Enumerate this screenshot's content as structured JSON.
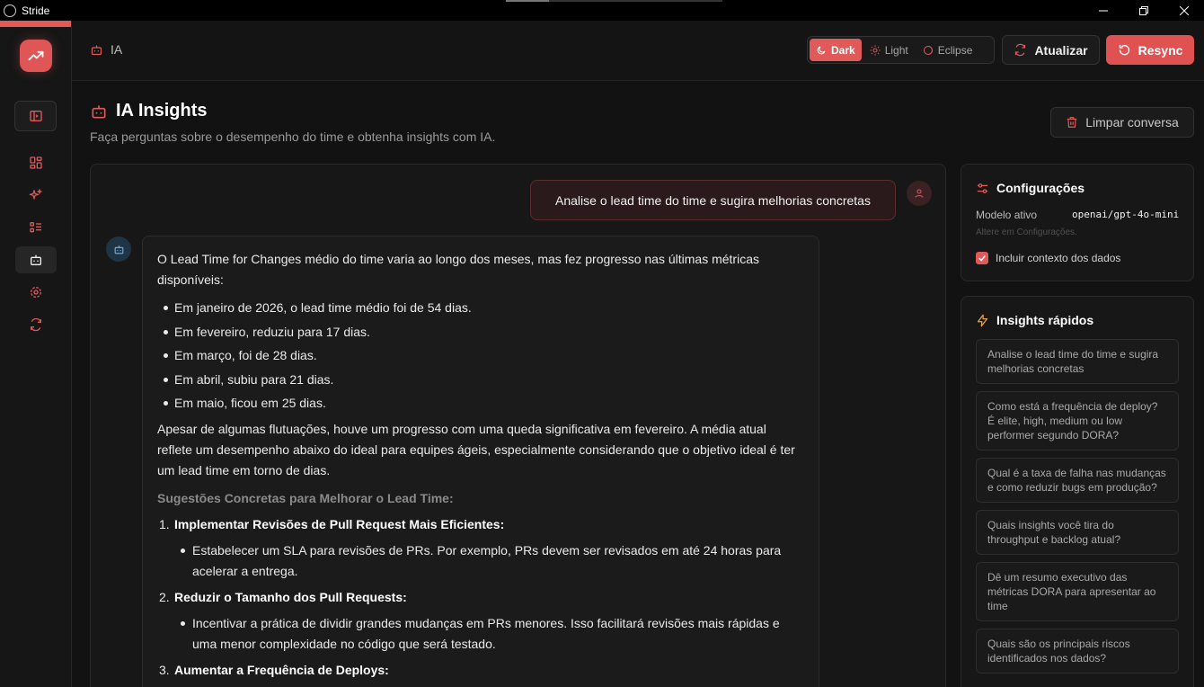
{
  "window": {
    "title": "Stride"
  },
  "topbar": {
    "breadcrumb": "IA",
    "themes": [
      "Dark",
      "Light",
      "Eclipse"
    ],
    "active_theme": "Dark",
    "refresh_label": "Atualizar",
    "resync_label": "Resync"
  },
  "page": {
    "title": "IA Insights",
    "subtitle": "Faça perguntas sobre o desempenho do time e obtenha insights com IA.",
    "clear_label": "Limpar conversa"
  },
  "chat": {
    "user_message": "Analise o lead time do time e sugira melhorias concretas",
    "reply": {
      "intro": "O Lead Time for Changes médio do time varia ao longo dos meses, mas fez progresso nas últimas métricas disponíveis:",
      "bullets": [
        "Em janeiro de 2026, o lead time médio foi de 54 dias.",
        "Em fevereiro, reduziu para 17 dias.",
        "Em março, foi de 28 dias.",
        "Em abril, subiu para 21 dias.",
        "Em maio, ficou em 25 dias."
      ],
      "summary": "Apesar de algumas flutuações, houve um progresso com uma queda significativa em fevereiro. A média atual reflete um desempenho abaixo do ideal para equipes ágeis, especialmente considerando que o objetivo ideal é ter um lead time em torno de dias.",
      "suggestions_heading": "Sugestões Concretas para Melhorar o Lead Time:",
      "steps": [
        {
          "num": "1.",
          "title": "Implementar Revisões de Pull Request Mais Eficientes:",
          "detail": "Estabelecer um SLA para revisões de PRs. Por exemplo, PRs devem ser revisados em até 24 horas para acelerar a entrega."
        },
        {
          "num": "2.",
          "title": "Reduzir o Tamanho dos Pull Requests:",
          "detail": "Incentivar a prática de dividir grandes mudanças em PRs menores. Isso facilitará revisões mais rápidas e uma menor complexidade no código que será testado."
        },
        {
          "num": "3.",
          "title": "Aumentar a Frequência de Deploys:",
          "detail": ""
        }
      ]
    }
  },
  "config": {
    "title": "Configurações",
    "model_label": "Modelo ativo",
    "model_value": "openai/gpt-4o-mini",
    "hint": "Altere em Configurações.",
    "include_context_label": "Incluir contexto dos dados",
    "include_context_checked": true
  },
  "quick": {
    "title": "Insights rápidos",
    "items": [
      "Analise o lead time do time e sugira melhorias concretas",
      "Como está a frequência de deploy? É elite, high, medium ou low performer segundo DORA?",
      "Qual é a taxa de falha nas mudanças e como reduzir bugs em produção?",
      "Quais insights você tira do throughput e backlog atual?",
      "Dê um resumo executivo das métricas DORA para apresentar ao time",
      "Quais são os principais riscos identificados nos dados?"
    ]
  },
  "colors": {
    "accent": "#e05a5a",
    "background": "#121212"
  }
}
